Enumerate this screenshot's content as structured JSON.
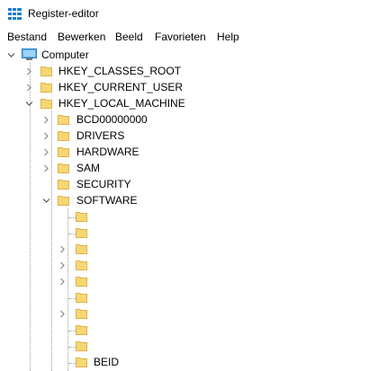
{
  "window": {
    "title": "Register-editor"
  },
  "menu": {
    "items": [
      "Bestand",
      "Bewerken",
      "Beeld",
      "Favorieten",
      "Help"
    ]
  },
  "tree": {
    "root": "Computer",
    "hives": [
      "HKEY_CLASSES_ROOT",
      "HKEY_CURRENT_USER",
      "HKEY_LOCAL_MACHINE"
    ],
    "hklm_children": [
      "BCD00000000",
      "DRIVERS",
      "HARDWARE",
      "SAM",
      "SECURITY",
      "SOFTWARE"
    ],
    "software_children": [
      "",
      "",
      "",
      "",
      "",
      "",
      "",
      "",
      "",
      "BEID"
    ]
  },
  "colors": {
    "folder": "#f7d774",
    "folder_edge": "#dcb24a",
    "chevron": "#8a8a8a",
    "app_icon": "#1e7dd1"
  }
}
